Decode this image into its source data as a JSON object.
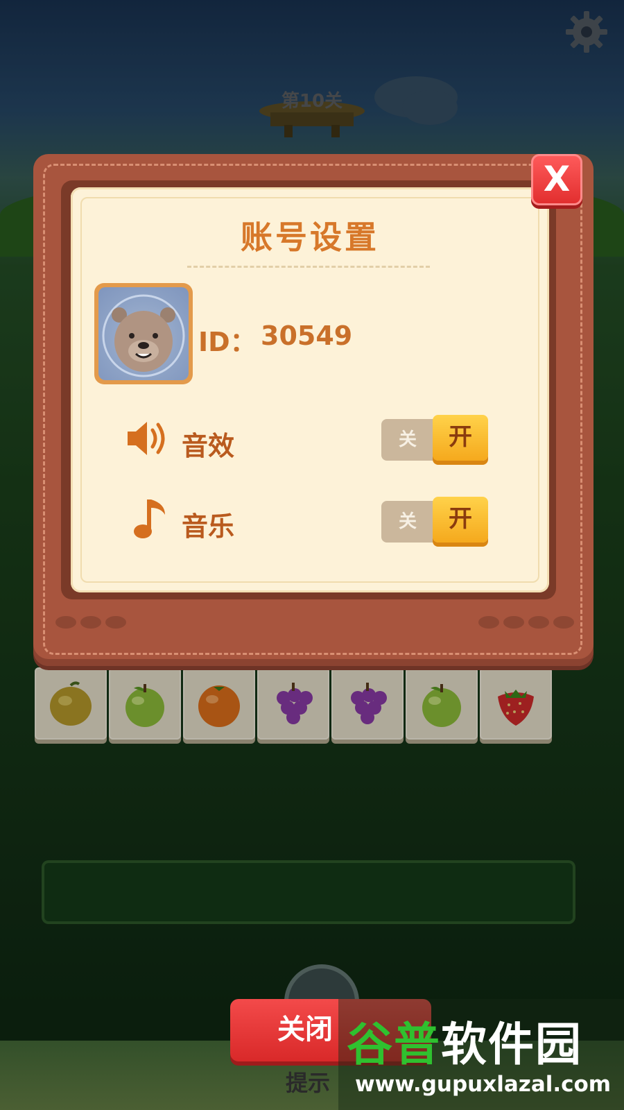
{
  "header": {
    "level_label": "第10关"
  },
  "dialog": {
    "title": "账号设置",
    "close_glyph": "X",
    "account": {
      "id_label": "ID：",
      "id_value": "30549",
      "avatar": "bear-avatar"
    },
    "settings": [
      {
        "icon": "speaker-icon",
        "label": "音效",
        "off_label": "关",
        "on_label": "开",
        "state": "on"
      },
      {
        "icon": "music-note-icon",
        "label": "音乐",
        "off_label": "关",
        "on_label": "开",
        "state": "on"
      }
    ]
  },
  "board": {
    "tiles": [
      "lemon",
      "green-apple",
      "orange",
      "grapes",
      "grapes",
      "green-apple",
      "strawberry"
    ]
  },
  "footer": {
    "close_label": "关闭",
    "hint_label": "提示"
  },
  "watermark": {
    "title_part1": "谷普",
    "title_part2": "软件园",
    "url": "www.gupuxlazal.com"
  },
  "colors": {
    "accent_orange": "#d7782a",
    "panel_bg": "#fdf2d8",
    "board_brown": "#a8553e",
    "close_red": "#e12d2d",
    "toggle_on": "#f5a91d",
    "toggle_off": "#cbb79c"
  }
}
